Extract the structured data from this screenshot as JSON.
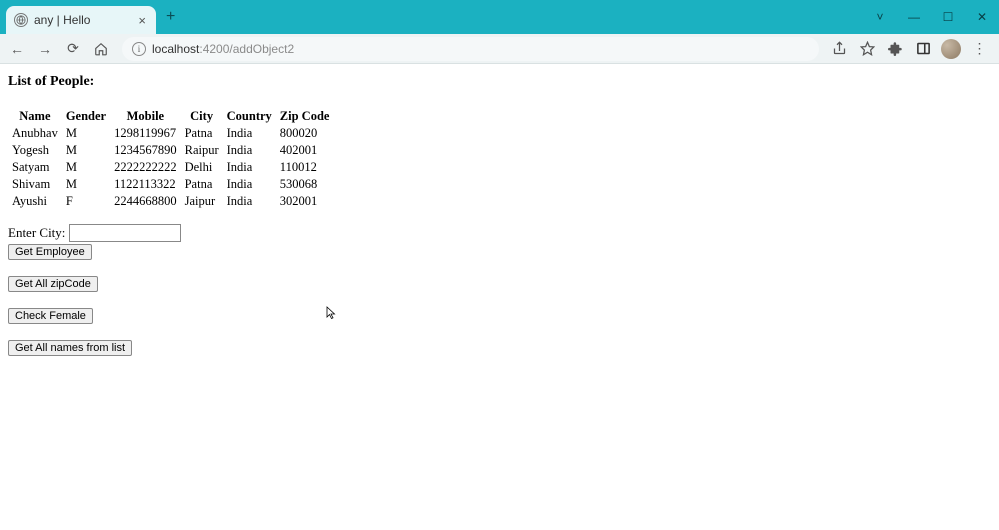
{
  "browser": {
    "tab_title": "any | Hello",
    "url_host": "localhost",
    "url_rest": ":4200/addObject2"
  },
  "page": {
    "heading": "List of People:",
    "table": {
      "headers": [
        "Name",
        "Gender",
        "Mobile",
        "City",
        "Country",
        "Zip Code"
      ],
      "rows": [
        {
          "name": "Anubhav",
          "gender": "M",
          "mobile": "1298119967",
          "city": "Patna",
          "country": "India",
          "zip": "800020"
        },
        {
          "name": "Yogesh",
          "gender": "M",
          "mobile": "1234567890",
          "city": "Raipur",
          "country": "India",
          "zip": "402001"
        },
        {
          "name": "Satyam",
          "gender": "M",
          "mobile": "2222222222",
          "city": "Delhi",
          "country": "India",
          "zip": "110012"
        },
        {
          "name": "Shivam",
          "gender": "M",
          "mobile": "1122113322",
          "city": "Patna",
          "country": "India",
          "zip": "530068"
        },
        {
          "name": "Ayushi",
          "gender": "F",
          "mobile": "2244668800",
          "city": "Jaipur",
          "country": "India",
          "zip": "302001"
        }
      ]
    },
    "labels": {
      "enter_city": "Enter City:"
    },
    "inputs": {
      "city_value": ""
    },
    "buttons": {
      "get_employee": "Get Employee",
      "get_all_zip": "Get All zipCode",
      "check_female": "Check Female",
      "get_all_names": "Get All names from list"
    }
  }
}
